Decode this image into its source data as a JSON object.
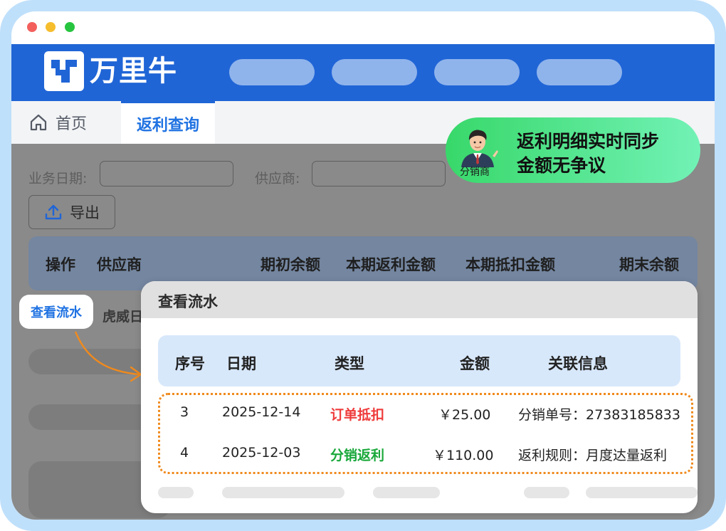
{
  "brand": {
    "name": "万里牛"
  },
  "tabs": {
    "home": "首页",
    "active": "返利查询"
  },
  "filters": {
    "date_label": "业务日期:",
    "supplier_label": "供应商:"
  },
  "toolbar": {
    "export_label": "导出"
  },
  "table": {
    "headers": [
      "操作",
      "供应商",
      "期初余额",
      "本期返利金额",
      "本期抵扣金额",
      "期末余额"
    ],
    "row_supplier_partial": "虎威日",
    "row_action": "查看流水"
  },
  "badge": {
    "caption": "分销商",
    "line1": "返利明细实时同步",
    "line2": "金额无争议"
  },
  "modal": {
    "title": "查看流水",
    "headers": [
      "序号",
      "日期",
      "类型",
      "金额",
      "关联信息"
    ],
    "rows": [
      {
        "seq": "3",
        "date": "2025-12-14",
        "type": "订单抵扣",
        "amount": "￥25.00",
        "info": "分销单号：27383185833"
      },
      {
        "seq": "4",
        "date": "2025-12-03",
        "type": "分销返利",
        "amount": "￥110.00",
        "info": "返利规则：月度达量返利"
      }
    ]
  },
  "colors": {
    "brand_blue": "#2065d6",
    "deduct_red": "#ef3b3b",
    "rebate_green": "#19a83a",
    "highlight_orange": "#f08a1d"
  }
}
